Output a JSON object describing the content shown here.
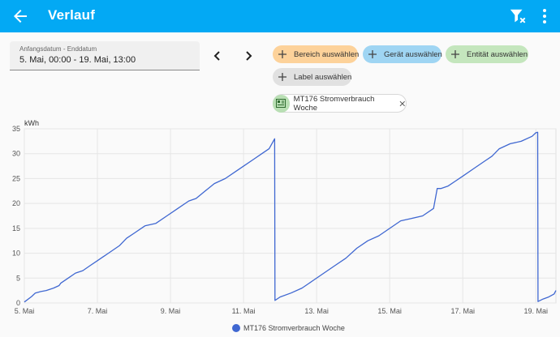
{
  "app_bar": {
    "title": "Verlauf",
    "background": "#03a9f4"
  },
  "date_range": {
    "label": "Anfangsdatum - Enddatum",
    "value": "5. Mai, 00:00 - 19. Mai, 13:00"
  },
  "target_chips": [
    {
      "label": "Bereich auswählen",
      "color": "#fdd29a"
    },
    {
      "label": "Gerät auswählen",
      "color": "#9fd5f3"
    },
    {
      "label": "Entität auswählen",
      "color": "#c4e6bd"
    },
    {
      "label": "Label auswählen",
      "color": "#e1e1e1"
    }
  ],
  "selected_entity": {
    "label": "MT176 Stromverbrauch Woche",
    "icon": "meter-icon"
  },
  "chart_data": {
    "type": "line",
    "ylabel": "kWh",
    "ylim": [
      0,
      35
    ],
    "yticks": [
      "0",
      "5",
      "10",
      "15",
      "20",
      "25",
      "30",
      "35"
    ],
    "xticks": [
      "5. Mai",
      "7. Mai",
      "9. Mai",
      "11. Mai",
      "13. Mai",
      "15. Mai",
      "17. Mai",
      "19. Mai"
    ],
    "xlim_days": [
      5,
      19.55
    ],
    "grid": true,
    "legend_position": "bottom",
    "series": [
      {
        "name": "MT176 Stromverbrauch Woche",
        "color": "#3f67d1",
        "x": [
          5.0,
          5.2,
          5.3,
          5.45,
          5.6,
          5.8,
          5.95,
          6.0,
          6.2,
          6.4,
          6.6,
          6.8,
          7.0,
          7.3,
          7.6,
          7.8,
          8.0,
          8.3,
          8.6,
          8.9,
          9.2,
          9.5,
          9.7,
          9.95,
          10.2,
          10.5,
          10.8,
          11.0,
          11.3,
          11.5,
          11.7,
          11.85,
          11.86,
          12.0,
          12.3,
          12.6,
          12.9,
          13.2,
          13.5,
          13.8,
          14.1,
          14.4,
          14.7,
          15.0,
          15.3,
          15.6,
          15.9,
          16.2,
          16.3,
          16.4,
          16.6,
          16.8,
          17.0,
          17.3,
          17.6,
          17.8,
          18.0,
          18.3,
          18.6,
          18.9,
          19.0,
          19.05,
          19.06,
          19.2,
          19.35,
          19.5,
          19.55
        ],
        "y": [
          0.2,
          1.3,
          2.0,
          2.3,
          2.5,
          3.0,
          3.5,
          4.0,
          5.0,
          6.0,
          6.5,
          7.5,
          8.5,
          10.0,
          11.5,
          13.0,
          14.0,
          15.5,
          16.0,
          17.5,
          19.0,
          20.5,
          21.0,
          22.5,
          24.0,
          25.0,
          26.5,
          27.5,
          29.0,
          30.0,
          31.0,
          33.0,
          0.5,
          1.2,
          2.0,
          3.0,
          4.5,
          6.0,
          7.5,
          9.0,
          11.0,
          12.5,
          13.5,
          15.0,
          16.5,
          17.0,
          17.5,
          19.0,
          23.0,
          23.0,
          23.5,
          24.5,
          25.5,
          27.0,
          28.5,
          29.5,
          31.0,
          32.0,
          32.5,
          33.5,
          34.2,
          34.3,
          0.3,
          0.8,
          1.2,
          1.8,
          2.5
        ]
      }
    ]
  }
}
